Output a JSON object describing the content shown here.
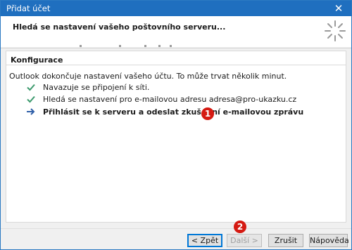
{
  "window": {
    "title": "Přidat účet",
    "close_symbol": "✕"
  },
  "header": {
    "heading": "Hledá se nastavení vašeho poštovního serveru..."
  },
  "section": {
    "title": "Konfigurace",
    "intro": "Outlook dokončuje nastavení vašeho účtu. To může trvat několik minut.",
    "steps": [
      {
        "label": "Navazuje se připojení k síti.",
        "status": "done",
        "icon": "checkmark-icon"
      },
      {
        "label": "Hledá se nastavení pro e-mailovou adresu adresa@pro-ukazku.cz",
        "status": "done",
        "icon": "checkmark-icon"
      },
      {
        "label": "Přihlásit se k serveru a odeslat zkušební e-mailovou zprávu",
        "status": "in-progress",
        "icon": "arrow-right-icon"
      }
    ]
  },
  "callouts": {
    "one": "1",
    "two": "2"
  },
  "buttons": {
    "back": "< Zpět",
    "next": "Další >",
    "cancel": "Zrušit",
    "help": "Nápověda"
  },
  "colors": {
    "titlebar": "#1f6fbf",
    "check": "#3c9a6d",
    "arrow": "#2f5fa8",
    "callout": "#d51a12"
  }
}
